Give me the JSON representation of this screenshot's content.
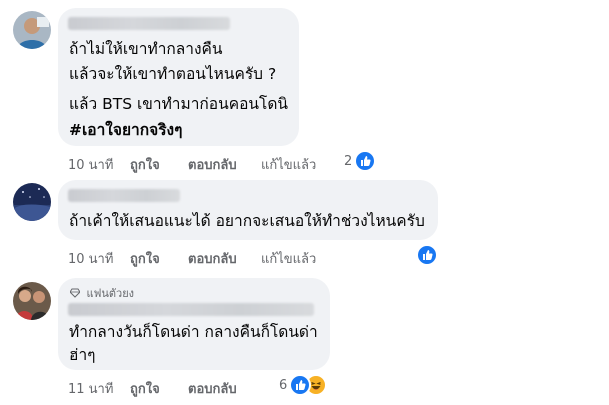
{
  "comments": [
    {
      "lines": [
        "ถ้าไม่ให้เขาทำกลางคืน",
        "แล้วจะให้เขาทำตอนไหนครับ ?",
        "แล้ว BTS เขาทำมาก่อนคอนโดนิ",
        "#เอาใจยากจริงๆ"
      ],
      "time": "10 นาที",
      "like": "ถูกใจ",
      "reply": "ตอบกลับ",
      "edited": "แก้ไขแล้ว",
      "reaction_count": "2"
    },
    {
      "lines": [
        "ถ้าเค้าให้เสนอแนะได้ อยากจะเสนอให้ทำช่วงไหนครับ"
      ],
      "time": "10 นาที",
      "like": "ถูกใจ",
      "reply": "ตอบกลับ",
      "edited": "แก้ไขแล้ว"
    },
    {
      "badge": "แฟนตัวยง",
      "lines": [
        "ทำกลางวันก็โดนด่า กลางคืนก็โดนด่า",
        "ฮ่าๆ"
      ],
      "time": "11 นาที",
      "like": "ถูกใจ",
      "reply": "ตอบกลับ",
      "reaction_count": "6"
    }
  ],
  "colors": {
    "bubble": "#f0f2f5",
    "meta": "#65676b",
    "like": "#1877f2"
  }
}
